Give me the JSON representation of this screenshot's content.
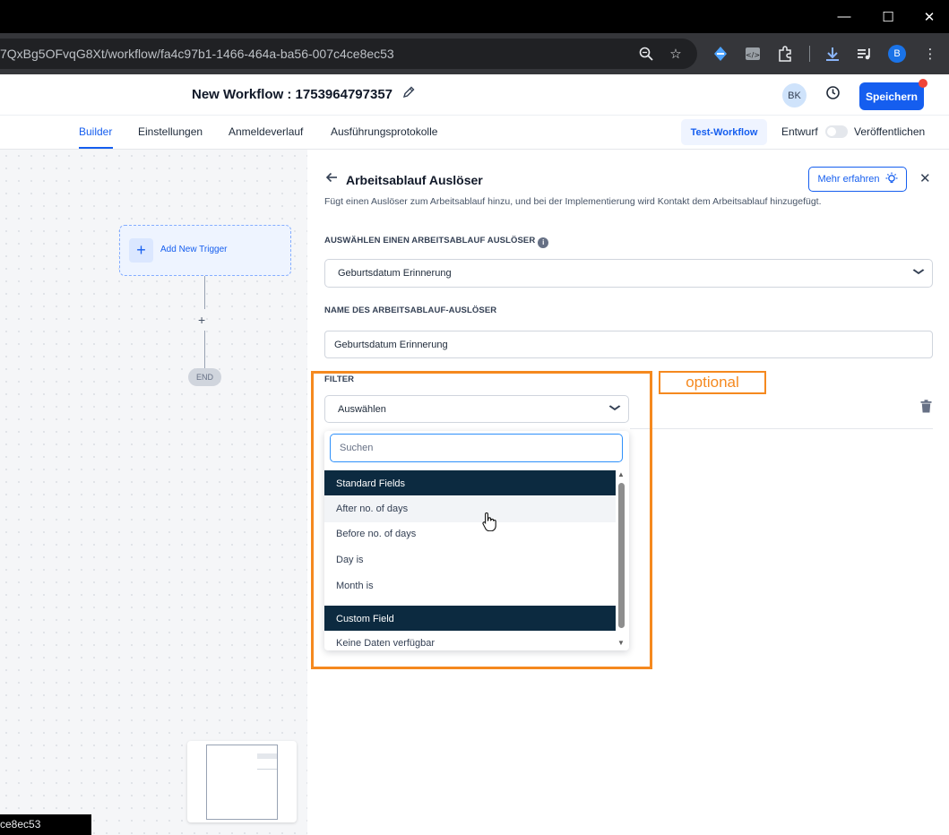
{
  "browser": {
    "url": "7QxBg5OFvqG8Xt/workflow/fa4c97b1-1466-464a-ba56-007c4ce8ec53",
    "profile_initial": "B",
    "status_url": "ce8ec53",
    "window_controls": {
      "minimize": "—",
      "maximize": "☐",
      "close": "✕"
    }
  },
  "header": {
    "workflow_title": "New Workflow : 1753964797357",
    "avatar_initials": "BK",
    "save_label": "Speichern"
  },
  "tabs": {
    "items": [
      {
        "label": "Builder",
        "active": true
      },
      {
        "label": "Einstellungen",
        "active": false
      },
      {
        "label": "Anmeldeverlauf",
        "active": false
      },
      {
        "label": "Ausführungsprotokolle",
        "active": false
      }
    ],
    "test_workflow_label": "Test-Workflow",
    "draft_label": "Entwurf",
    "publish_label": "Veröffentlichen",
    "publish_toggle_on": false
  },
  "canvas": {
    "trigger_label": "Add New Trigger",
    "plus_label": "+",
    "end_label": "END"
  },
  "panel": {
    "title": "Arbeitsablauf Auslöser",
    "learn_more_label": "Mehr erfahren",
    "description": "Fügt einen Auslöser zum Arbeitsablauf hinzu, und bei der Implementierung wird Kontakt dem Arbeitsablauf hinzugefügt.",
    "trigger_select_label": "AUSWÄHLEN EINEN ARBEITSABLAUF AUSLÖSER",
    "trigger_select_value": "Geburtsdatum Erinnerung",
    "trigger_name_label": "NAME DES ARBEITSABLAUF-AUSLÖSER",
    "trigger_name_value": "Geburtsdatum Erinnerung",
    "filter_label": "FILTER",
    "filter_select_value": "Auswählen"
  },
  "dropdown": {
    "search_placeholder": "Suchen",
    "groups": [
      {
        "header": "Standard Fields",
        "items": [
          "After no. of days",
          "Before no. of days",
          "Day is",
          "Month is"
        ]
      },
      {
        "header": "Custom Field",
        "items": [
          "Keine Daten verfügbar"
        ]
      }
    ],
    "hovered_item": "After no. of days"
  },
  "annotation": {
    "label": "optional",
    "color": "#f5891f"
  },
  "colors": {
    "primary": "#155eef",
    "dropdown_header": "#0c2a40"
  }
}
